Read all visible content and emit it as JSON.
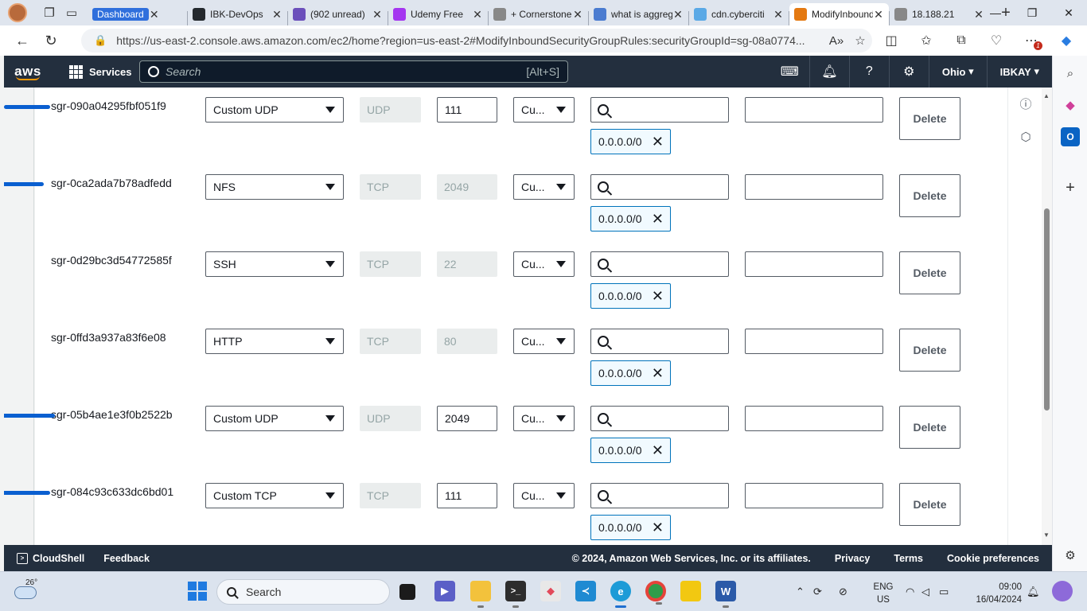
{
  "browser": {
    "tabs": [
      {
        "title": "Dashboard",
        "color": "#2f6fdc",
        "icon": "dashboard-tab-icon"
      },
      {
        "title": "IBK-DevOps",
        "color": "#24292e",
        "icon": "github-icon"
      },
      {
        "title": "(902 unread)",
        "color": "#6b4fbb",
        "icon": "mail-icon"
      },
      {
        "title": "Udemy Free",
        "color": "#a435f0",
        "icon": "udemy-icon"
      },
      {
        "title": "+ Cornerstone",
        "color": "#888888",
        "icon": "page-icon"
      },
      {
        "title": "what is aggregate",
        "color": "#4a7bd0",
        "icon": "search-icon"
      },
      {
        "title": "cdn.cyberciti",
        "color": "#5aa9e6",
        "icon": "cdn-icon"
      },
      {
        "title": "ModifyInbound",
        "color": "#e47911",
        "icon": "aws-tab-icon"
      },
      {
        "title": "18.188.21",
        "color": "#888888",
        "icon": "page-icon"
      }
    ],
    "url": "https://us-east-2.console.aws.amazon.com/ec2/home?region=us-east-2#ModifyInboundSecurityGroupRules:securityGroupId=sg-08a0774...",
    "notification_count": "1"
  },
  "aws": {
    "logo": "aws",
    "services_label": "Services",
    "search_placeholder": "Search",
    "search_shortcut": "[Alt+S]",
    "region": "Ohio",
    "account": "IBKAY",
    "accent": "#ff9900",
    "header_bg": "#232f3e"
  },
  "rules": [
    {
      "id": "sgr-090a04295fbf051f9",
      "type": "Custom UDP",
      "protocol": "UDP",
      "port": "111",
      "port_editable": true,
      "source": "Cu...",
      "cidr": "0.0.0.0/0",
      "delete_label": "Delete",
      "scribbled": true
    },
    {
      "id": "sgr-0ca2ada7b78adfedd",
      "type": "NFS",
      "protocol": "TCP",
      "port": "2049",
      "port_editable": false,
      "source": "Cu...",
      "cidr": "0.0.0.0/0",
      "delete_label": "Delete",
      "scribbled": true
    },
    {
      "id": "sgr-0d29bc3d54772585f",
      "type": "SSH",
      "protocol": "TCP",
      "port": "22",
      "port_editable": false,
      "source": "Cu...",
      "cidr": "0.0.0.0/0",
      "delete_label": "Delete",
      "scribbled": false
    },
    {
      "id": "sgr-0ffd3a937a83f6e08",
      "type": "HTTP",
      "protocol": "TCP",
      "port": "80",
      "port_editable": false,
      "source": "Cu...",
      "cidr": "0.0.0.0/0",
      "delete_label": "Delete",
      "scribbled": false
    },
    {
      "id": "sgr-05b4ae1e3f0b2522b",
      "type": "Custom UDP",
      "protocol": "UDP",
      "port": "2049",
      "port_editable": true,
      "source": "Cu...",
      "cidr": "0.0.0.0/0",
      "delete_label": "Delete",
      "scribbled": true
    },
    {
      "id": "sgr-084c93c633dc6bd01",
      "type": "Custom TCP",
      "protocol": "TCP",
      "port": "111",
      "port_editable": true,
      "source": "Cu...",
      "cidr": "0.0.0.0/0",
      "delete_label": "Delete",
      "scribbled": true
    }
  ],
  "footer": {
    "cloudshell": "CloudShell",
    "feedback": "Feedback",
    "copyright": "© 2024, Amazon Web Services, Inc. or its affiliates.",
    "privacy": "Privacy",
    "terms": "Terms",
    "cookies": "Cookie preferences"
  },
  "taskbar": {
    "temperature": "26°",
    "search_label": "Search",
    "lang_top": "ENG",
    "lang_bottom": "US",
    "time": "09:00",
    "date": "16/04/2024"
  }
}
